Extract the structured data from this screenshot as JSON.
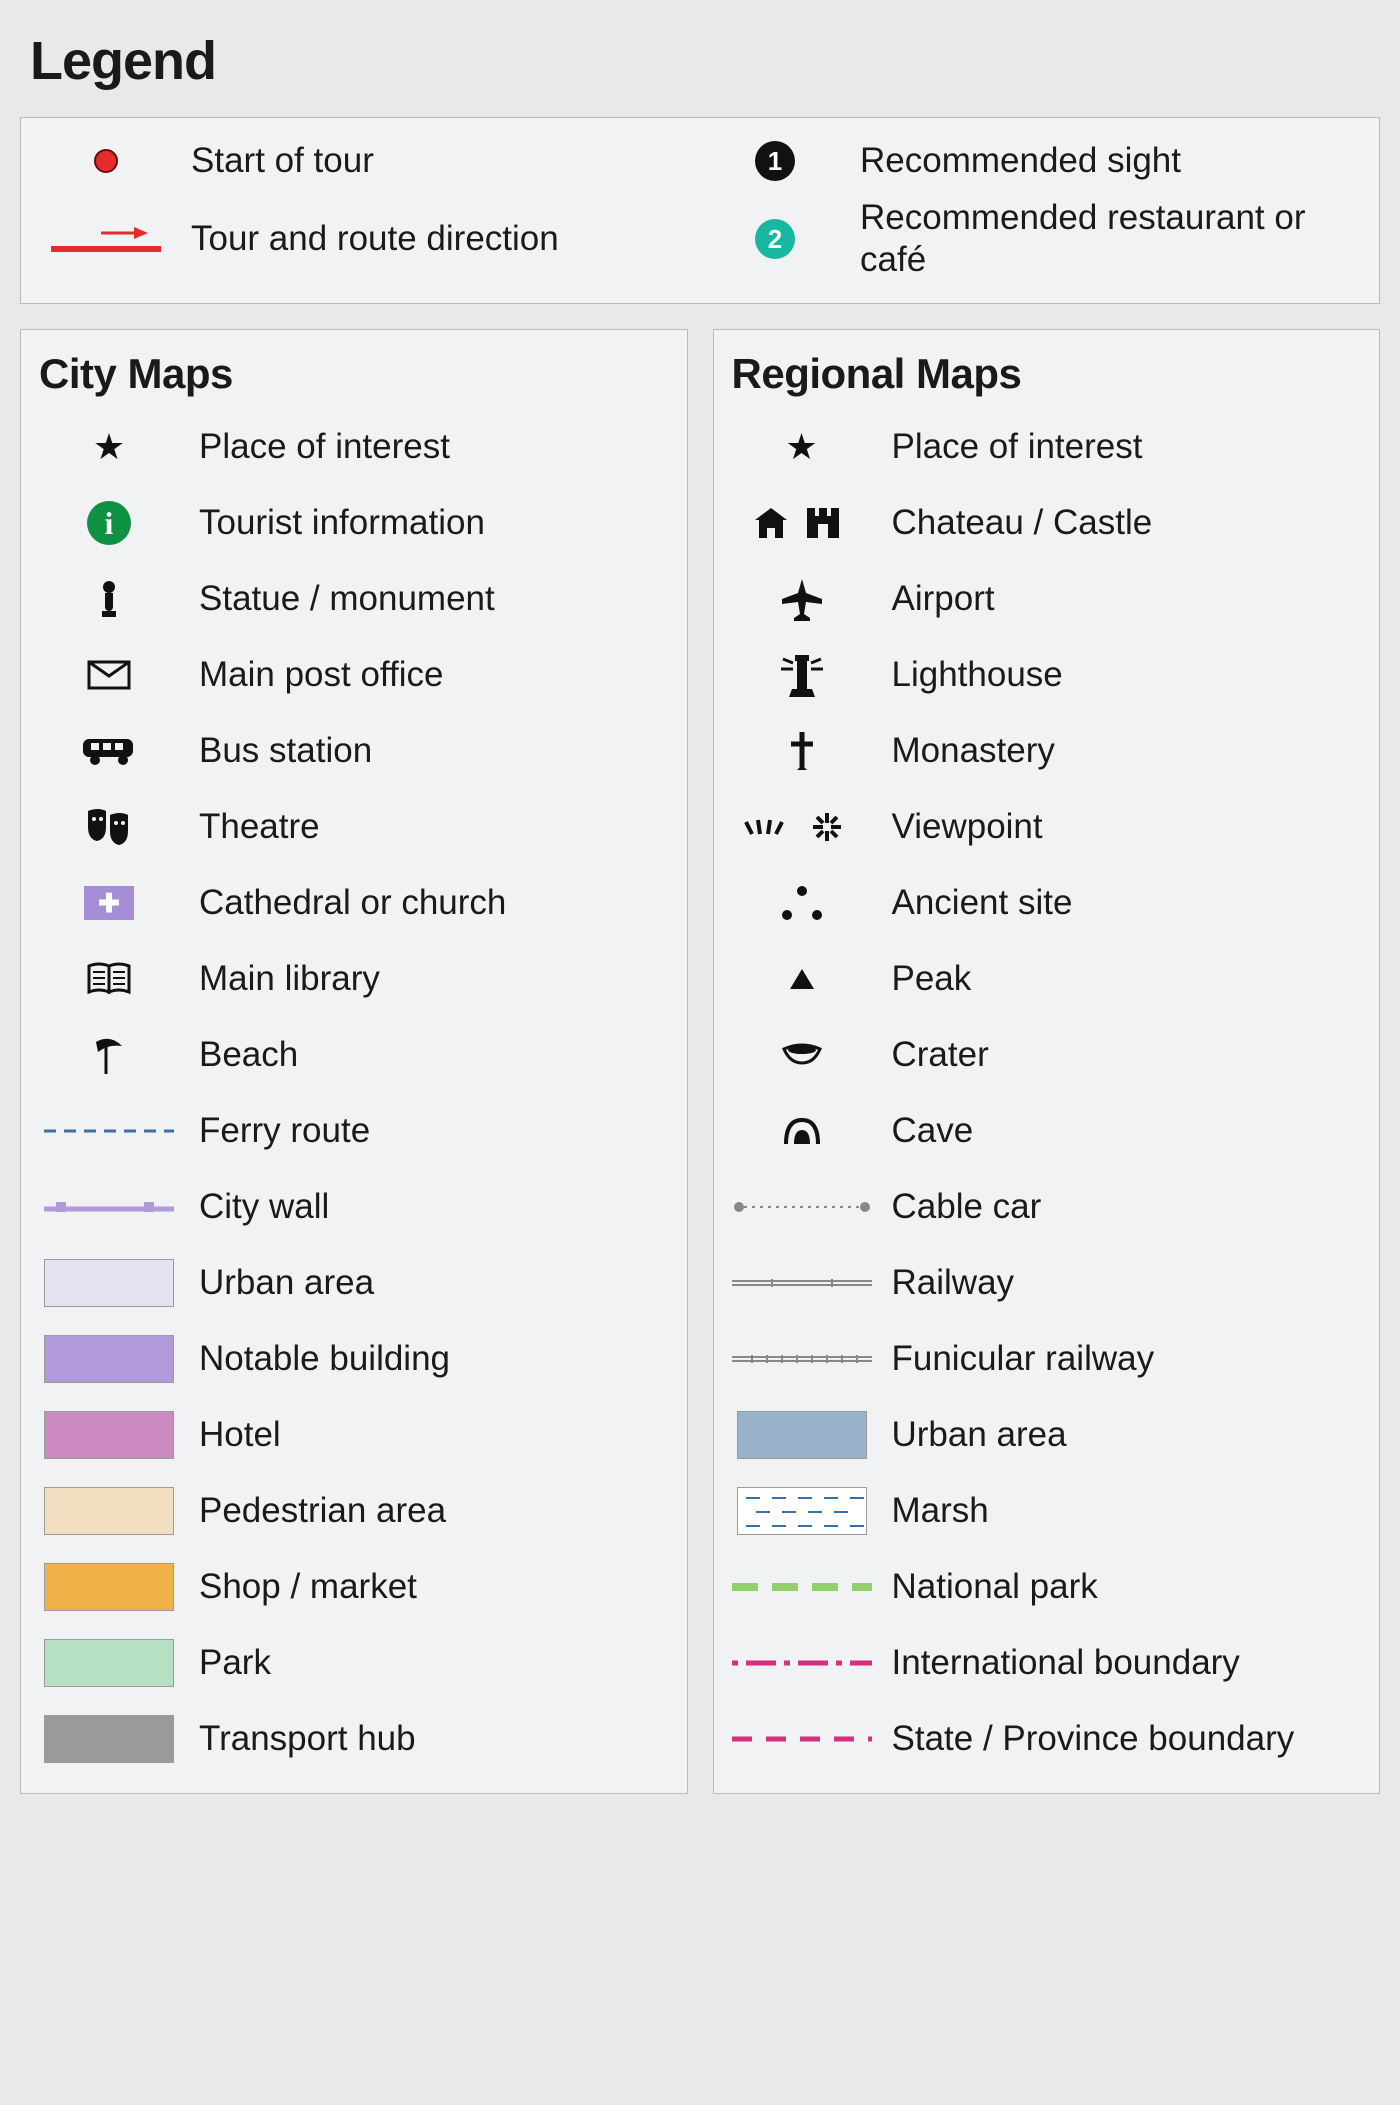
{
  "title": "Legend",
  "top": {
    "start": "Start of tour",
    "route": "Tour and route direction",
    "sight": "Recommended sight",
    "restaurant": "Recommended restaurant or café"
  },
  "cityTitle": "City Maps",
  "city": {
    "poi": "Place of interest",
    "tourist_info": "Tourist information",
    "statue": "Statue / monument",
    "post": "Main post office",
    "bus": "Bus station",
    "theatre": "Theatre",
    "church": "Cathedral or church",
    "library": "Main library",
    "beach": "Beach",
    "ferry": "Ferry route",
    "city_wall": "City wall",
    "urban": "Urban area",
    "notable": "Notable building",
    "hotel": "Hotel",
    "pedestrian": "Pedestrian area",
    "shop": "Shop / market",
    "park": "Park",
    "transport": "Transport hub"
  },
  "regionTitle": "Regional Maps",
  "region": {
    "poi": "Place of interest",
    "chateau": "Chateau / Castle",
    "airport": "Airport",
    "lighthouse": "Lighthouse",
    "monastery": "Monastery",
    "viewpoint": "Viewpoint",
    "ancient": "Ancient site",
    "peak": "Peak",
    "crater": "Crater",
    "cave": "Cave",
    "cablecar": "Cable car",
    "railway": "Railway",
    "funicular": "Funicular railway",
    "urban": "Urban area",
    "marsh": "Marsh",
    "natpark": "National park",
    "intl": "International boundary",
    "state": "State / Province boundary"
  },
  "colors": {
    "red": "#e52b2b",
    "teal": "#17b7a1",
    "green": "#0f9144",
    "lilac": "#a58ed6",
    "urban_light": "#e6e2f3",
    "notable": "#b299d9",
    "hotel": "#cb8abf",
    "pedestrian": "#f2dfc2",
    "shop": "#f2b24a",
    "park": "#b5e0c1",
    "grey": "#9a9a9a",
    "blue": "#3b6fa7",
    "region_urban": "#97b2c9",
    "natpark_green": "#93cf6f",
    "magenta": "#d4307f"
  }
}
